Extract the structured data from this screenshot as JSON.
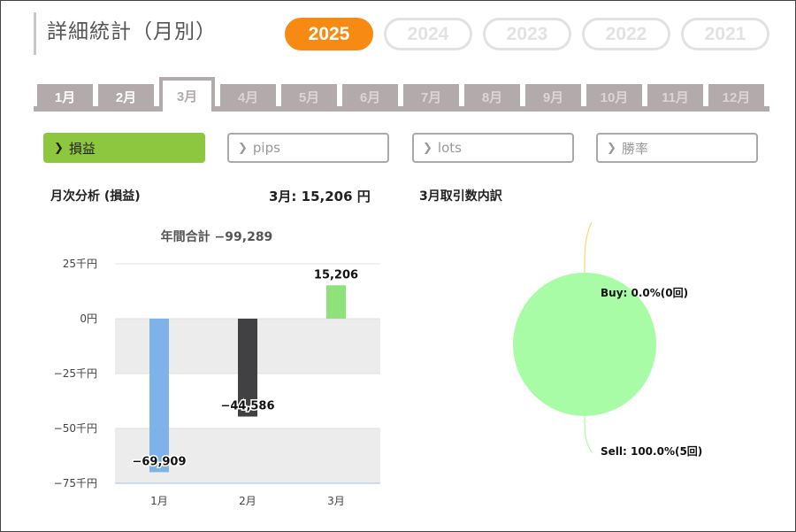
{
  "page_title": "詳細統計（月別）",
  "years": [
    {
      "label": "2025",
      "active": true
    },
    {
      "label": "2024",
      "active": false
    },
    {
      "label": "2023",
      "active": false
    },
    {
      "label": "2022",
      "active": false
    },
    {
      "label": "2021",
      "active": false
    }
  ],
  "months": [
    "1月",
    "2月",
    "3月",
    "4月",
    "5月",
    "6月",
    "7月",
    "8月",
    "9月",
    "10月",
    "11月",
    "12月"
  ],
  "active_month_index": 2,
  "metric_tabs": [
    {
      "label": "損益",
      "active": true
    },
    {
      "label": "pips",
      "active": false
    },
    {
      "label": "lots",
      "active": false
    },
    {
      "label": "勝率",
      "active": false
    }
  ],
  "monthly_analysis_label": "月次分析 (損益)",
  "month_summary": "3月:  15,206 円",
  "breakdown_label": "3月取引数内訳",
  "colors": {
    "accent_orange": "#f68a12",
    "metric_active": "#8dc63f",
    "tab_gray": "#b3abab"
  },
  "chart_data": [
    {
      "type": "bar",
      "title": "年間合計 −99,289",
      "categories": [
        "1月",
        "2月",
        "3月"
      ],
      "values": [
        -69909,
        -44586,
        15206
      ],
      "value_labels": [
        "−69,909",
        "−44,586",
        "15,206"
      ],
      "bar_colors": [
        "#7db3e8",
        "#414144",
        "#8ee27a"
      ],
      "y_ticks": [
        25000,
        0,
        -25000,
        -50000,
        -75000
      ],
      "y_tick_labels": [
        "25千円",
        "0円",
        "−25千円",
        "−50千円",
        "−75千円"
      ],
      "ylim": [
        -75000,
        25000
      ],
      "grid": true
    },
    {
      "type": "pie",
      "labels": [
        "Buy",
        "Sell"
      ],
      "values": [
        0.0,
        100.0
      ],
      "counts": [
        0,
        5
      ],
      "label_text": [
        "Buy: 0.0%(0回)",
        "Sell: 100.0%(5回)"
      ],
      "colors": [
        "#f6d77a",
        "#a9fca6"
      ]
    }
  ]
}
